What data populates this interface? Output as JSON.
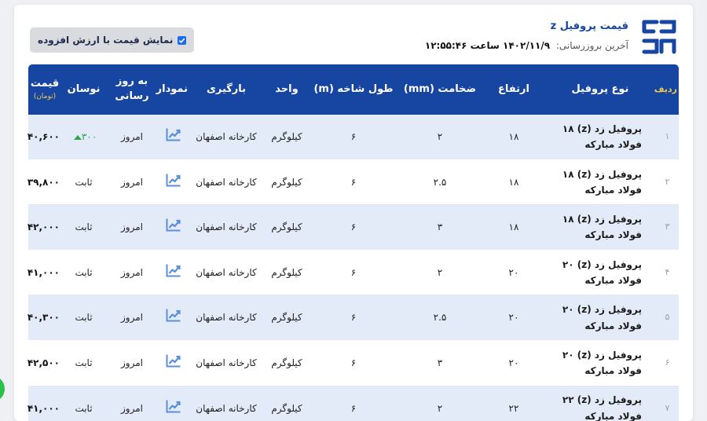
{
  "header": {
    "title": "قیمت پروفیل z",
    "updated_label": "آخرین بروزرسانی:",
    "updated_value": "۱۴۰۲/۱۱/۹ ساعت ۱۲:۵۵:۴۶"
  },
  "vat_toggle": {
    "label": "نمایش قیمت با ارزش افزوده",
    "checked": true
  },
  "table": {
    "headers": {
      "index": "ردیف",
      "name": "نوع پروفیل",
      "height": "ارتفاع",
      "thickness": "ضخامت (mm)",
      "length": "طول شاخه (m)",
      "unit": "واحد",
      "loading": "بارگیری",
      "chart": "نمودار",
      "updated": "به روز رسانی",
      "change": "نوسان",
      "price": "قیمت",
      "price_unit": "(تومان)"
    },
    "rows": [
      {
        "index": "۱",
        "name": "پروفیل زد (z) ۱۸ فولاد مبارکه",
        "height": "۱۸",
        "thickness": "۲",
        "length": "۶",
        "unit": "کیلوگرم",
        "loading": "کارخانه اصفهان",
        "updated": "امروز",
        "change": "۳۰۰",
        "change_dir": "up",
        "price": "۴۰,۶۰۰"
      },
      {
        "index": "۲",
        "name": "پروفیل زد (z) ۱۸ فولاد مبارکه",
        "height": "۱۸",
        "thickness": "۲.۵",
        "length": "۶",
        "unit": "کیلوگرم",
        "loading": "کارخانه اصفهان",
        "updated": "امروز",
        "change": "ثابت",
        "change_dir": "flat",
        "price": "۳۹,۸۰۰"
      },
      {
        "index": "۳",
        "name": "پروفیل زد (z) ۱۸ فولاد مبارکه",
        "height": "۱۸",
        "thickness": "۳",
        "length": "۶",
        "unit": "کیلوگرم",
        "loading": "کارخانه اصفهان",
        "updated": "امروز",
        "change": "ثابت",
        "change_dir": "flat",
        "price": "۴۲,۰۰۰"
      },
      {
        "index": "۴",
        "name": "پروفیل زد (z) ۲۰ فولاد مبارکه",
        "height": "۲۰",
        "thickness": "۲",
        "length": "۶",
        "unit": "کیلوگرم",
        "loading": "کارخانه اصفهان",
        "updated": "امروز",
        "change": "ثابت",
        "change_dir": "flat",
        "price": "۴۱,۰۰۰"
      },
      {
        "index": "۵",
        "name": "پروفیل زد (z) ۲۰ فولاد مبارکه",
        "height": "۲۰",
        "thickness": "۲.۵",
        "length": "۶",
        "unit": "کیلوگرم",
        "loading": "کارخانه اصفهان",
        "updated": "امروز",
        "change": "ثابت",
        "change_dir": "flat",
        "price": "۴۰,۳۰۰"
      },
      {
        "index": "۶",
        "name": "پروفیل زد (z) ۲۰ فولاد مبارکه",
        "height": "۲۰",
        "thickness": "۳",
        "length": "۶",
        "unit": "کیلوگرم",
        "loading": "کارخانه اصفهان",
        "updated": "امروز",
        "change": "ثابت",
        "change_dir": "flat",
        "price": "۴۲,۵۰۰"
      },
      {
        "index": "۷",
        "name": "پروفیل زد (z) ۲۲ فولاد مبارکه",
        "height": "۲۲",
        "thickness": "۲",
        "length": "۶",
        "unit": "کیلوگرم",
        "loading": "کارخانه اصفهان",
        "updated": "امروز",
        "change": "ثابت",
        "change_dir": "flat",
        "price": "۴۱,۰۰۰"
      }
    ]
  },
  "colors": {
    "brand": "#1746a2",
    "header_accent": "#f3c94a",
    "row_alt": "#e3ebf8",
    "up": "#2aa84a",
    "fab": "#2cc04a"
  },
  "icons": {
    "logo": "brand-logo-icon",
    "chart": "line-chart-icon",
    "check": "check-icon",
    "up": "triangle-up-icon"
  }
}
